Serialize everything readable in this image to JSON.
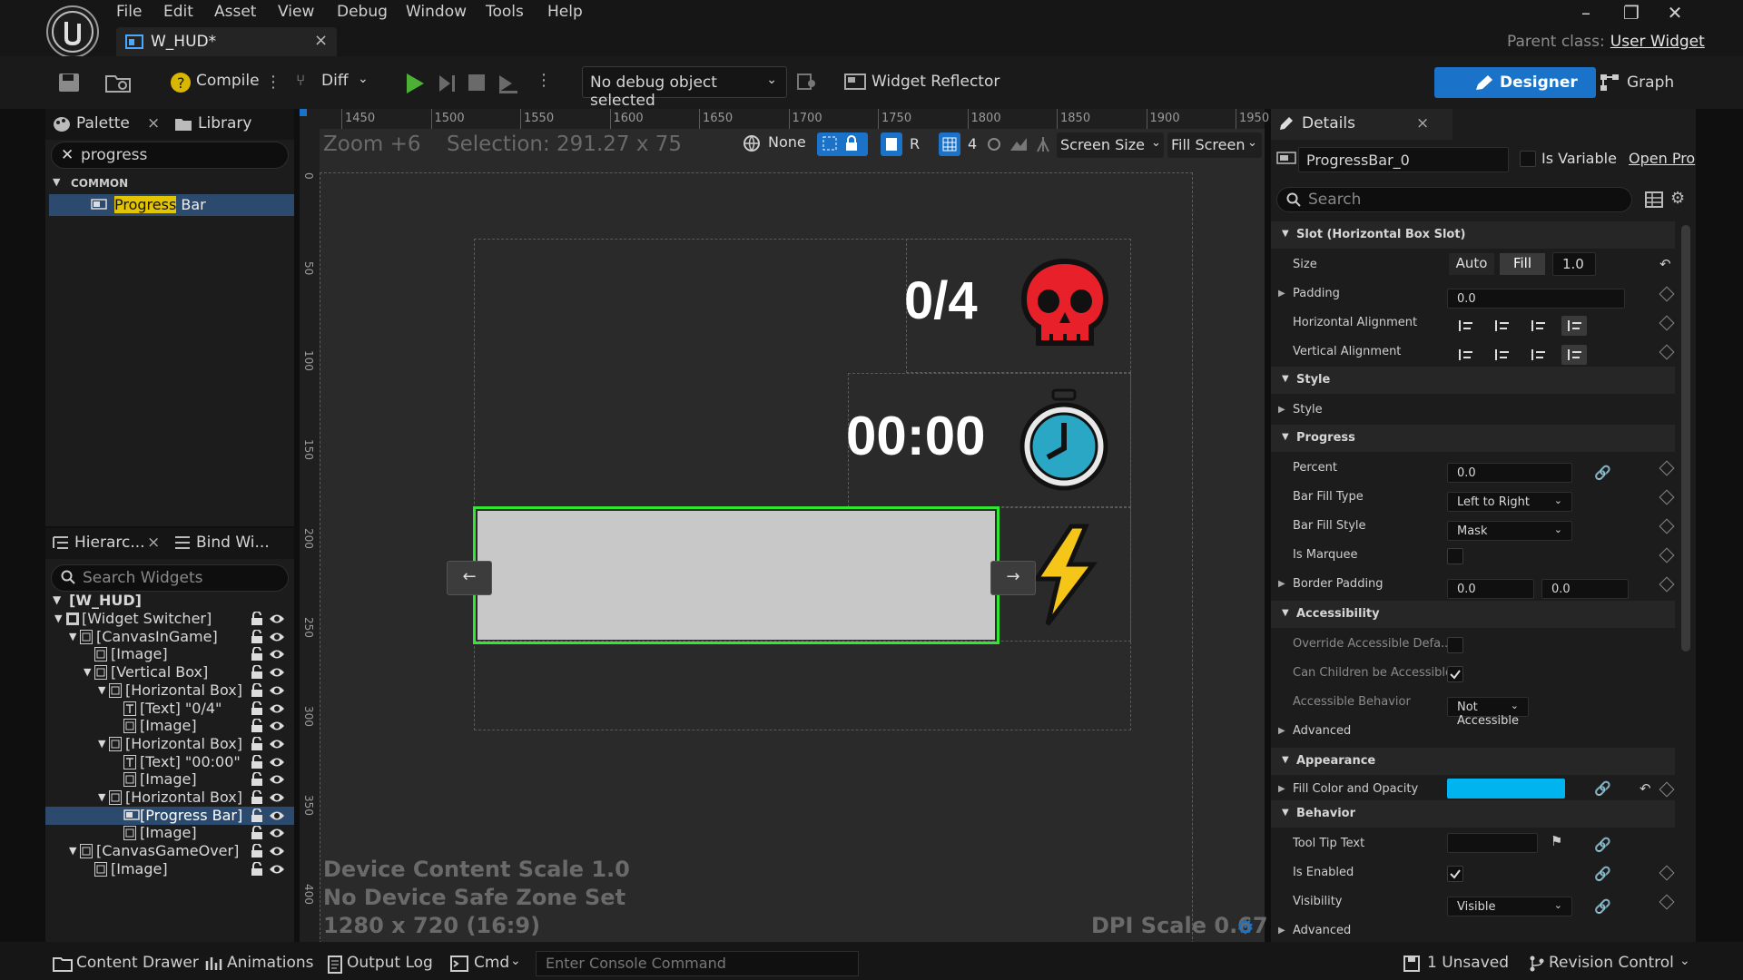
{
  "menu": [
    "File",
    "Edit",
    "Asset",
    "View",
    "Debug",
    "Window",
    "Tools",
    "Help"
  ],
  "document_tab": {
    "title": "W_HUD*"
  },
  "parent_class": {
    "label": "Parent class:",
    "value": "User Widget"
  },
  "toolbar": {
    "compile": "Compile",
    "diff": "Diff",
    "debug_object": "No debug object selected",
    "widget_reflector": "Widget Reflector",
    "designer": "Designer",
    "graph": "Graph"
  },
  "palette": {
    "tab_palette": "Palette",
    "tab_library": "Library",
    "search_value": "progress",
    "category": "COMMON",
    "item_highlight": "Progress",
    "item_rest": " Bar"
  },
  "hierarchy": {
    "tab_hierarchy": "Hierarc...",
    "tab_bind": "Bind Wi...",
    "search_placeholder": "Search Widgets",
    "root": "[W_HUD]",
    "rows": [
      {
        "label": "[Widget Switcher]"
      },
      {
        "label": "[CanvasInGame]"
      },
      {
        "label": "[Image]"
      },
      {
        "label": "[Vertical Box]"
      },
      {
        "label": "[Horizontal Box]"
      },
      {
        "label": "[Text] \"0/4\""
      },
      {
        "label": "[Image]"
      },
      {
        "label": "[Horizontal Box]"
      },
      {
        "label": "[Text] \"00:00\""
      },
      {
        "label": "[Image]"
      },
      {
        "label": "[Horizontal Box]"
      },
      {
        "label": "[Progress Bar]"
      },
      {
        "label": "[Image]"
      },
      {
        "label": "[CanvasGameOver]"
      },
      {
        "label": "[Image]"
      }
    ]
  },
  "viewport": {
    "zoom": "Zoom +6",
    "selection": "Selection: 291.27 x 75",
    "localization": "None",
    "r_label": "R",
    "grid_snap": "4",
    "screen_size": "Screen Size",
    "fill_screen": "Fill Screen",
    "ruler_ticks": [
      "1450",
      "1500",
      "1550",
      "1600",
      "1650",
      "1700",
      "1750",
      "1800",
      "1850",
      "1900",
      "1950"
    ],
    "ruler_left_ticks": [
      "0",
      "50",
      "100",
      "150",
      "200",
      "250",
      "300",
      "350",
      "400"
    ],
    "kills_text": "0/4",
    "timer_text": "00:00",
    "device_scale": "Device Content Scale 1.0",
    "safe_zone": "No Device Safe Zone Set",
    "resolution": "1280 x 720 (16:9)",
    "dpi_scale": "DPI Scale 0.67",
    "progress_percent": 0.0
  },
  "details": {
    "tab": "Details",
    "widget_name": "ProgressBar_0",
    "is_variable": "Is Variable",
    "open_pro": "Open Pro",
    "search_placeholder": "Search",
    "slot_section": "Slot (Horizontal Box Slot)",
    "size_label": "Size",
    "size_auto": "Auto",
    "size_fill": "Fill",
    "size_value": "1.0",
    "padding_label": "Padding",
    "padding_value": "0.0",
    "halign_label": "Horizontal Alignment",
    "valign_label": "Vertical Alignment",
    "style_section": "Style",
    "style_label": "Style",
    "progress_section": "Progress",
    "percent_label": "Percent",
    "percent_value": "0.0",
    "bar_fill_type_label": "Bar Fill Type",
    "bar_fill_type_value": "Left to Right",
    "bar_fill_style_label": "Bar Fill Style",
    "bar_fill_style_value": "Mask",
    "is_marquee_label": "Is Marquee",
    "border_padding_label": "Border Padding",
    "border_padding_x": "0.0",
    "border_padding_y": "0.0",
    "accessibility_section": "Accessibility",
    "override_label": "Override Accessible Defa...",
    "can_children_label": "Can Children be Accessible",
    "acc_behavior_label": "Accessible Behavior",
    "acc_behavior_value": "Not Accessible",
    "advanced_label": "Advanced",
    "appearance_section": "Appearance",
    "fill_color_label": "Fill Color and Opacity",
    "fill_color": "#00b4f0",
    "behavior_section": "Behavior",
    "tooltip_label": "Tool Tip Text",
    "is_enabled_label": "Is Enabled",
    "visibility_label": "Visibility",
    "visibility_value": "Visible",
    "advanced2_label": "Advanced"
  },
  "statusbar": {
    "content_drawer": "Content Drawer",
    "animations": "Animations",
    "output_log": "Output Log",
    "cmd": "Cmd",
    "console_placeholder": "Enter Console Command",
    "unsaved": "1 Unsaved",
    "revision_control": "Revision Control"
  },
  "colors": {
    "accent": "#1a73c8",
    "selection_green": "#33e633",
    "progress_fill": "#00b4f0",
    "skull_red": "#e8202a"
  }
}
